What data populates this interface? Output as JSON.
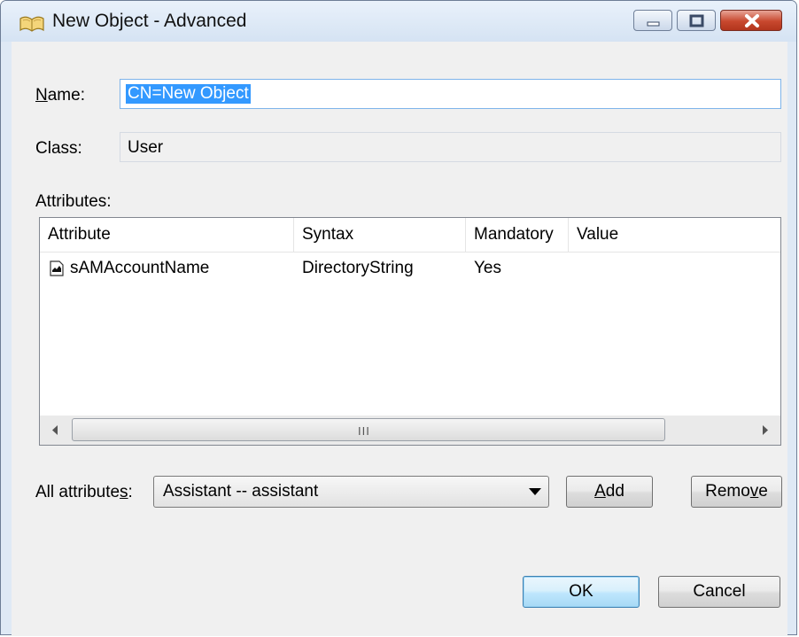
{
  "window": {
    "title": "New Object - Advanced",
    "icon": "address-book-icon",
    "controls": [
      "minimize-icon",
      "maximize-icon",
      "close-icon"
    ]
  },
  "name": {
    "label_pre": "",
    "label_accel": "N",
    "label_post": "ame:",
    "value": "CN=New Object"
  },
  "class": {
    "label": "Class:",
    "value": "User"
  },
  "attributes": {
    "label": "Attributes:",
    "columns": [
      "Attribute",
      "Syntax",
      "Mandatory",
      "Value"
    ],
    "rows": [
      {
        "attribute": "sAMAccountName",
        "syntax": "DirectoryString",
        "mandatory": "Yes",
        "value": "",
        "icon": "attribute-icon"
      }
    ],
    "scrollbar_grip": "III"
  },
  "all_attributes": {
    "label_pre": "All attribute",
    "label_accel": "s",
    "label_post": ":",
    "selected": "Assistant  --  assistant"
  },
  "buttons": {
    "add_accel": "A",
    "add_rest": "dd",
    "remove_pre": "Remo",
    "remove_accel": "v",
    "remove_post": "e",
    "ok": "OK",
    "cancel": "Cancel"
  },
  "colors": {
    "selection": "#3399ff",
    "titlebar": "#dfe9f5",
    "close": "#c8482e"
  }
}
